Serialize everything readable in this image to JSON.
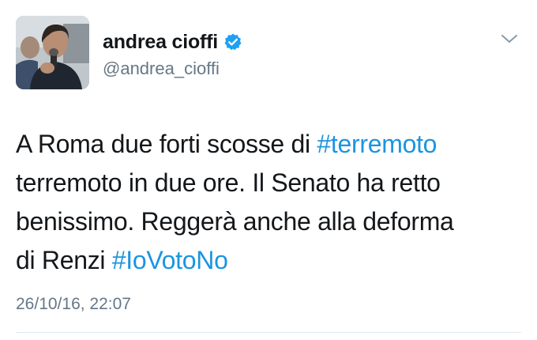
{
  "author": {
    "display_name": "andrea cioffi",
    "handle": "@andrea_cioffi",
    "verified": true,
    "verified_icon": "verified-badge-icon",
    "avatar": "profile-photo"
  },
  "tweet": {
    "lines": [
      {
        "text": "A Roma due forti scosse di ",
        "hashtag": "#terremoto"
      },
      {
        "text": "terremoto in due ore. Il Senato ha retto",
        "hashtag": ""
      },
      {
        "text": "benissimo. Reggerà anche alla deforma",
        "hashtag": ""
      },
      {
        "text": "di Renzi ",
        "hashtag": "#IoVotoNo"
      }
    ],
    "timestamp": "26/10/16, 22:07"
  },
  "menu": {
    "icon": "chevron-down-icon"
  },
  "colors": {
    "text": "#14171a",
    "secondary": "#657786",
    "link": "#1b95e0",
    "verified": "#1da1f2",
    "divider": "#e1e8ed"
  }
}
